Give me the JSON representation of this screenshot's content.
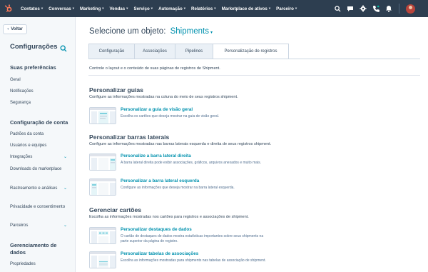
{
  "topnav": {
    "items": [
      {
        "label": "Contatos"
      },
      {
        "label": "Conversas"
      },
      {
        "label": "Marketing"
      },
      {
        "label": "Vendas"
      },
      {
        "label": "Serviço"
      },
      {
        "label": "Automação"
      },
      {
        "label": "Relatórios"
      },
      {
        "label": "Marketplace de ativos"
      },
      {
        "label": "Parceiro"
      }
    ],
    "right_icons": [
      "search-icon",
      "help-icon",
      "settings-icon",
      "calling-icon",
      "notifications-icon"
    ],
    "colors": {
      "bar": "#2d3e50",
      "logo": "#ff7a59"
    }
  },
  "sidebar": {
    "back_label": "Voltar",
    "title": "Configurações",
    "sections": [
      {
        "title": "Suas preferências",
        "items": [
          {
            "label": "Geral"
          },
          {
            "label": "Notificações"
          },
          {
            "label": "Segurança"
          }
        ]
      },
      {
        "title": "Configuração de conta",
        "items": [
          {
            "label": "Padrões da conta"
          },
          {
            "label": "Usuários e equipes"
          },
          {
            "label": "Integrações"
          },
          {
            "label": "Downloads do marketplace"
          },
          {
            "label": "Rastreamento e análises"
          },
          {
            "label": "Privacidade e consentimento"
          },
          {
            "label": "Parceiros"
          }
        ]
      },
      {
        "title": "Gerenciamento de dados",
        "items": [
          {
            "label": "Propriedades"
          }
        ]
      }
    ]
  },
  "main": {
    "heading_prefix": "Selecione um objeto:",
    "object_selected": "Shipments",
    "tabs": [
      {
        "label": "Configuração"
      },
      {
        "label": "Associações"
      },
      {
        "label": "Pipelines"
      },
      {
        "label": "Personalização de registros"
      }
    ],
    "active_tab": "Personalização de registros",
    "intro": "Controle o layout e o conteúdo de suas páginas de registros de Shipment.",
    "sections": [
      {
        "title": "Personalizar guias",
        "description": "Configure as informações mostradas na coluna do meio de seus registros shipment.",
        "cards": [
          {
            "link": "Personalizar a guia de visão geral",
            "description": "Escolha os cartões que deseja mostrar na guia de visão geral."
          }
        ]
      },
      {
        "title": "Personalizar barras laterais",
        "description": "Configure as informações mostradas nas barras laterais esquerda e direita de seus registros shipment.",
        "cards": [
          {
            "link": "Personalize a barra lateral direita",
            "description": "A barra lateral direita pode exibir associações, gráficos, arquivos anexados e muito mais."
          },
          {
            "link": "Personalizar a barra lateral esquerda",
            "description": "Configure as informações que deseja mostrar na barra lateral esquerda."
          }
        ]
      },
      {
        "title": "Gerenciar cartões",
        "description": "Escolha as informações mostradas nos cartões para registros e associações de shipment.",
        "cards": [
          {
            "link": "Personalizar destaques de dados",
            "description": "O cartão de destaques de dados mostra estatísticas importantes sobre seus shipments na parte superior da página de registro."
          },
          {
            "link": "Personalizar tabelas de associações",
            "description": "Escolha as informações mostradas para shipments nas tabelas de associação de shipment."
          }
        ]
      }
    ],
    "colors": {
      "link": "#0091ae",
      "text": "#33475b"
    }
  }
}
